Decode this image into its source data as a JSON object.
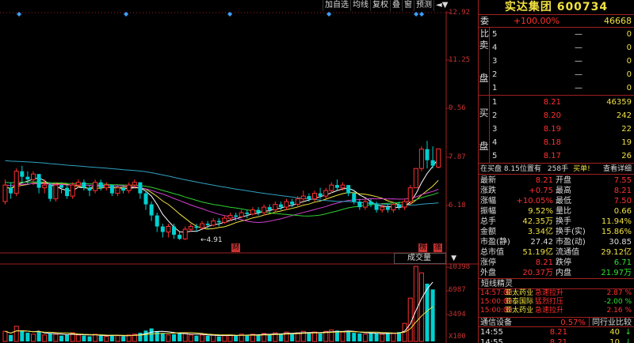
{
  "toolbar": {
    "items": [
      "加自选",
      "均线",
      "复权",
      "叠",
      "窗",
      "预测",
      "◄▼"
    ]
  },
  "price_axis": [
    "12.92",
    "11.25",
    "9.56",
    "7.87",
    "6.18"
  ],
  "volume_axis": [
    "10398",
    "6987",
    "3494",
    "X100"
  ],
  "annotations": {
    "low_label": "←4.91",
    "tag_cai": "财",
    "tag_bang": "榜",
    "tag_zhang": "涨"
  },
  "volume_selector": "成交量",
  "colors": {
    "up": "#ff3030",
    "down": "#00d0d0",
    "ma5": "#ffffff",
    "ma10": "#f0e040",
    "ma20": "#d040d0",
    "ma30": "#30d030",
    "ma60": "#30a0c0"
  },
  "chart_data": {
    "type": "candlestick",
    "ylim": [
      4.5,
      13.2
    ],
    "candles": [
      {
        "o": 6.3,
        "c": 6.9,
        "h": 7.1,
        "l": 6.2
      },
      {
        "o": 6.8,
        "c": 6.6,
        "h": 7.0,
        "l": 6.4
      },
      {
        "o": 6.6,
        "c": 7.4,
        "h": 7.5,
        "l": 6.5
      },
      {
        "o": 7.4,
        "c": 7.2,
        "h": 7.6,
        "l": 7.0
      },
      {
        "o": 7.2,
        "c": 7.1,
        "h": 7.4,
        "l": 6.9
      },
      {
        "o": 7.1,
        "c": 7.3,
        "h": 7.4,
        "l": 6.9
      },
      {
        "o": 7.3,
        "c": 6.8,
        "h": 7.3,
        "l": 6.6
      },
      {
        "o": 6.8,
        "c": 6.9,
        "h": 7.1,
        "l": 6.6
      },
      {
        "o": 6.9,
        "c": 6.4,
        "h": 7.0,
        "l": 6.3
      },
      {
        "o": 6.4,
        "c": 6.9,
        "h": 7.0,
        "l": 6.3
      },
      {
        "o": 6.9,
        "c": 6.8,
        "h": 7.0,
        "l": 6.6
      },
      {
        "o": 6.8,
        "c": 6.5,
        "h": 6.9,
        "l": 6.4
      },
      {
        "o": 6.5,
        "c": 6.9,
        "h": 7.0,
        "l": 6.4
      },
      {
        "o": 6.9,
        "c": 7.0,
        "h": 7.1,
        "l": 6.8
      },
      {
        "o": 7.0,
        "c": 6.8,
        "h": 7.1,
        "l": 6.7
      },
      {
        "o": 6.8,
        "c": 6.7,
        "h": 6.9,
        "l": 6.5
      },
      {
        "o": 6.7,
        "c": 7.0,
        "h": 7.1,
        "l": 6.6
      },
      {
        "o": 7.0,
        "c": 6.8,
        "h": 7.1,
        "l": 6.7
      },
      {
        "o": 6.8,
        "c": 6.9,
        "h": 7.0,
        "l": 6.7
      },
      {
        "o": 6.9,
        "c": 6.6,
        "h": 6.9,
        "l": 6.5
      },
      {
        "o": 6.6,
        "c": 6.8,
        "h": 6.9,
        "l": 6.5
      },
      {
        "o": 6.8,
        "c": 6.7,
        "h": 6.9,
        "l": 6.6
      },
      {
        "o": 6.7,
        "c": 6.9,
        "h": 7.0,
        "l": 6.6
      },
      {
        "o": 6.9,
        "c": 7.0,
        "h": 7.1,
        "l": 6.8
      },
      {
        "o": 7.0,
        "c": 6.6,
        "h": 7.0,
        "l": 6.4
      },
      {
        "o": 6.6,
        "c": 6.2,
        "h": 6.7,
        "l": 6.0
      },
      {
        "o": 6.2,
        "c": 5.8,
        "h": 6.3,
        "l": 5.6
      },
      {
        "o": 5.8,
        "c": 5.4,
        "h": 5.9,
        "l": 5.2
      },
      {
        "o": 5.4,
        "c": 5.2,
        "h": 5.5,
        "l": 5.0
      },
      {
        "o": 5.2,
        "c": 5.4,
        "h": 5.5,
        "l": 5.0
      },
      {
        "o": 5.4,
        "c": 5.1,
        "h": 5.5,
        "l": 4.95
      },
      {
        "o": 5.1,
        "c": 4.95,
        "h": 5.2,
        "l": 4.91
      },
      {
        "o": 4.95,
        "c": 5.3,
        "h": 5.4,
        "l": 4.91
      },
      {
        "o": 5.3,
        "c": 5.4,
        "h": 5.5,
        "l": 5.2
      },
      {
        "o": 5.4,
        "c": 5.35,
        "h": 5.5,
        "l": 5.2
      },
      {
        "o": 5.35,
        "c": 5.5,
        "h": 5.6,
        "l": 5.3
      },
      {
        "o": 5.5,
        "c": 5.45,
        "h": 5.6,
        "l": 5.3
      },
      {
        "o": 5.45,
        "c": 5.6,
        "h": 5.7,
        "l": 5.4
      },
      {
        "o": 5.6,
        "c": 5.55,
        "h": 5.7,
        "l": 5.4
      },
      {
        "o": 5.55,
        "c": 5.7,
        "h": 5.8,
        "l": 5.5
      },
      {
        "o": 5.7,
        "c": 5.8,
        "h": 5.9,
        "l": 5.6
      },
      {
        "o": 5.8,
        "c": 5.75,
        "h": 5.9,
        "l": 5.6
      },
      {
        "o": 5.75,
        "c": 5.9,
        "h": 6.0,
        "l": 5.7
      },
      {
        "o": 5.9,
        "c": 5.85,
        "h": 6.0,
        "l": 5.7
      },
      {
        "o": 5.85,
        "c": 6.0,
        "h": 6.1,
        "l": 5.8
      },
      {
        "o": 6.0,
        "c": 5.9,
        "h": 6.1,
        "l": 5.8
      },
      {
        "o": 5.9,
        "c": 6.1,
        "h": 6.2,
        "l": 5.8
      },
      {
        "o": 6.1,
        "c": 6.0,
        "h": 6.2,
        "l": 5.9
      },
      {
        "o": 6.0,
        "c": 6.2,
        "h": 6.3,
        "l": 5.9
      },
      {
        "o": 6.2,
        "c": 6.1,
        "h": 6.3,
        "l": 6.0
      },
      {
        "o": 6.1,
        "c": 6.3,
        "h": 6.4,
        "l": 6.0
      },
      {
        "o": 6.3,
        "c": 6.2,
        "h": 6.4,
        "l": 6.1
      },
      {
        "o": 6.2,
        "c": 6.4,
        "h": 6.5,
        "l": 6.1
      },
      {
        "o": 6.4,
        "c": 6.5,
        "h": 6.7,
        "l": 6.3
      },
      {
        "o": 6.5,
        "c": 6.4,
        "h": 6.6,
        "l": 6.3
      },
      {
        "o": 6.4,
        "c": 6.6,
        "h": 6.7,
        "l": 6.3
      },
      {
        "o": 6.6,
        "c": 6.5,
        "h": 6.8,
        "l": 6.4
      },
      {
        "o": 6.5,
        "c": 6.7,
        "h": 6.8,
        "l": 6.4
      },
      {
        "o": 6.7,
        "c": 6.9,
        "h": 7.0,
        "l": 6.6
      },
      {
        "o": 6.9,
        "c": 6.8,
        "h": 7.1,
        "l": 6.7
      },
      {
        "o": 6.8,
        "c": 6.9,
        "h": 7.0,
        "l": 6.7
      },
      {
        "o": 6.9,
        "c": 6.6,
        "h": 6.9,
        "l": 6.5
      },
      {
        "o": 6.6,
        "c": 6.3,
        "h": 6.7,
        "l": 6.2
      },
      {
        "o": 6.3,
        "c": 6.1,
        "h": 6.4,
        "l": 6.0
      },
      {
        "o": 6.1,
        "c": 6.3,
        "h": 6.4,
        "l": 6.0
      },
      {
        "o": 6.3,
        "c": 6.2,
        "h": 6.4,
        "l": 6.1
      },
      {
        "o": 6.2,
        "c": 6.0,
        "h": 6.3,
        "l": 5.9
      },
      {
        "o": 6.0,
        "c": 6.1,
        "h": 6.2,
        "l": 5.9
      },
      {
        "o": 6.1,
        "c": 6.0,
        "h": 6.2,
        "l": 5.9
      },
      {
        "o": 6.0,
        "c": 6.2,
        "h": 6.3,
        "l": 5.9
      },
      {
        "o": 6.2,
        "c": 6.1,
        "h": 6.3,
        "l": 6.0
      },
      {
        "o": 6.1,
        "c": 6.3,
        "h": 6.4,
        "l": 6.0
      },
      {
        "o": 6.3,
        "c": 6.8,
        "h": 6.9,
        "l": 6.2
      },
      {
        "o": 6.8,
        "c": 7.5,
        "h": 7.5,
        "l": 6.8
      },
      {
        "o": 7.5,
        "c": 8.2,
        "h": 8.3,
        "l": 7.4
      },
      {
        "o": 8.2,
        "c": 7.8,
        "h": 8.5,
        "l": 7.5
      },
      {
        "o": 7.8,
        "c": 7.6,
        "h": 8.3,
        "l": 7.5
      },
      {
        "o": 7.55,
        "c": 8.21,
        "h": 8.21,
        "l": 7.5
      }
    ],
    "volumes": [
      1400,
      900,
      2100,
      1500,
      1200,
      1000,
      1300,
      900,
      1100,
      1000,
      800,
      900,
      1200,
      900,
      800,
      700,
      1000,
      800,
      700,
      900,
      800,
      700,
      900,
      1000,
      1200,
      1500,
      1800,
      1400,
      1100,
      900,
      1000,
      1200,
      1100,
      900,
      800,
      900,
      800,
      900,
      700,
      800,
      900,
      800,
      1000,
      900,
      1000,
      900,
      1100,
      1000,
      1200,
      1000,
      1300,
      1100,
      1200,
      1400,
      1200,
      1300,
      1100,
      1400,
      1600,
      1500,
      1300,
      1400,
      1200,
      1100,
      1000,
      1200,
      1100,
      1000,
      1200,
      1100,
      1300,
      2500,
      6000,
      10398,
      9500,
      8000,
      7200
    ],
    "price_axis_labels": [
      "12.92",
      "11.25",
      "9.56",
      "7.87",
      "6.18"
    ],
    "volume_axis_labels": [
      "10398",
      "6987",
      "3494",
      "X100"
    ]
  },
  "panel": {
    "title": "实达集团 600734",
    "weibi": {
      "label": "委比",
      "pct": "+100.00%",
      "value": "46668"
    },
    "sell_side_label": [
      "卖",
      "盘"
    ],
    "buy_side_label": [
      "买",
      "盘"
    ],
    "sell": [
      {
        "n": "5",
        "p": "",
        "q": "0"
      },
      {
        "n": "4",
        "p": "",
        "q": "0"
      },
      {
        "n": "3",
        "p": "",
        "q": "0"
      },
      {
        "n": "2",
        "p": "",
        "q": "0"
      },
      {
        "n": "1",
        "p": "",
        "q": "0"
      }
    ],
    "sell_dash": "—",
    "buy": [
      {
        "n": "1",
        "p": "8.21",
        "q": "46359"
      },
      {
        "n": "2",
        "p": "8.20",
        "q": "242"
      },
      {
        "n": "3",
        "p": "8.19",
        "q": "22"
      },
      {
        "n": "4",
        "p": "8.18",
        "q": "19"
      },
      {
        "n": "5",
        "p": "8.17",
        "q": "26"
      }
    ],
    "queue": {
      "a": "在买盘 8.15位置有",
      "b": "258手",
      "c": "买单!",
      "d": "查看详细"
    },
    "stats": [
      {
        "k": "最新",
        "v": "8.21",
        "vc": "red",
        "k2": "开盘",
        "v2": "7.55",
        "v2c": "red"
      },
      {
        "k": "涨跌",
        "v": "+0.75",
        "vc": "red",
        "k2": "最高",
        "v2": "8.21",
        "v2c": "red"
      },
      {
        "k": "涨幅",
        "v": "+10.05%",
        "vc": "red",
        "k2": "最低",
        "v2": "7.50",
        "v2c": "red"
      },
      {
        "k": "振幅",
        "v": "9.52%",
        "vc": "yel",
        "k2": "量比",
        "v2": "0.66",
        "v2c": "yel"
      },
      {
        "k": "总手",
        "v": "42.35万",
        "vc": "yel",
        "k2": "换手",
        "v2": "11.94%",
        "v2c": "yel"
      },
      {
        "k": "金额",
        "v": "3.34亿",
        "vc": "yel",
        "k2": "换手(实)",
        "v2": "15.86%",
        "v2c": "yel"
      },
      {
        "k": "市盈(静)",
        "v": "27.42",
        "vc": "wht",
        "k2": "市盈(动)",
        "v2": "30.85",
        "v2c": "wht"
      },
      {
        "k": "总市值",
        "v": "51.19亿",
        "vc": "yel",
        "k2": "流通值",
        "v2": "29.12亿",
        "v2c": "yel"
      },
      {
        "k": "涨停",
        "v": "8.21",
        "vc": "red",
        "k2": "跌停",
        "v2": "6.71",
        "v2c": "grn"
      },
      {
        "k": "外盘",
        "v": "20.37万",
        "vc": "red",
        "k2": "内盘",
        "v2": "21.97万",
        "v2c": "grn"
      }
    ],
    "spirit_title": "短线精灵",
    "spirit": [
      {
        "t": "14:57:00",
        "n": "亚太药业",
        "e": "急速拉升",
        "pc": "2.87 %"
      },
      {
        "t": "15:00:09",
        "n": "亚泰国际",
        "e": "猛烈打压",
        "pc": "-2.00 %"
      },
      {
        "t": "15:00:09",
        "n": "亚太药业",
        "e": "急速拉升",
        "pc": "2.16 %"
      }
    ],
    "tabs": {
      "t1": "通信设备",
      "t2": "0.57%",
      "t3": "同行业比较"
    },
    "ticks": [
      {
        "t": "14:55",
        "p": "8.21",
        "v": "40"
      },
      {
        "t": "14:55",
        "p": "8.21",
        "v": "10"
      }
    ]
  }
}
